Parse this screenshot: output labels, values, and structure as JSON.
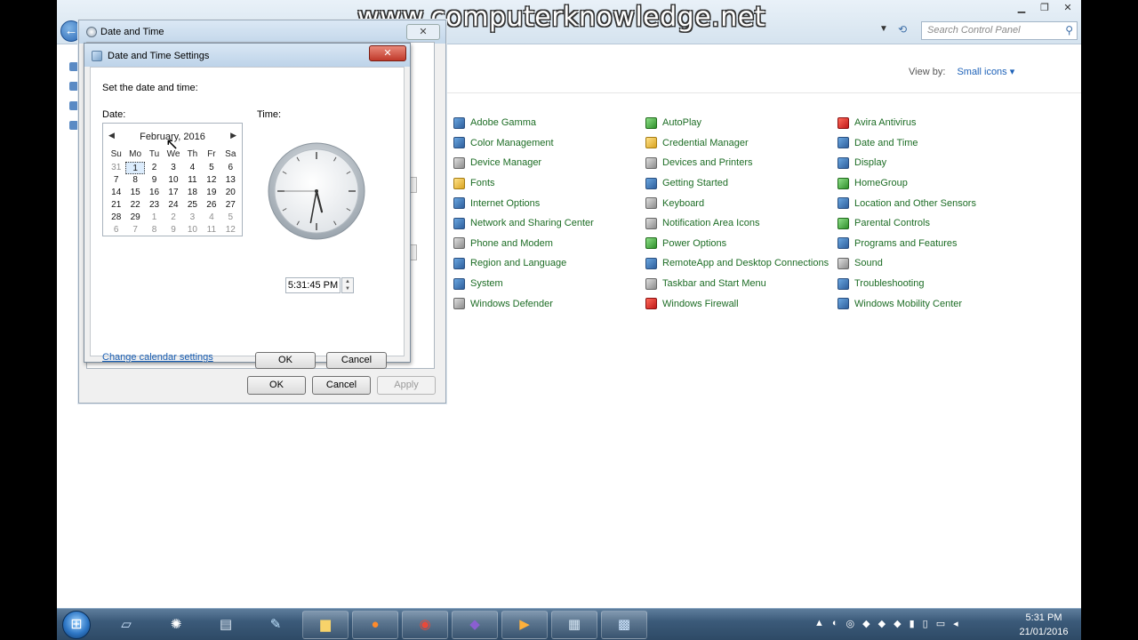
{
  "watermark": "www.computerknowledge.net",
  "explorer": {
    "search_placeholder": "Search Control Panel",
    "view_by_label": "View by:",
    "view_by_value": "Small icons ▾"
  },
  "control_panel_items": [
    {
      "label": "Adobe Gamma",
      "icon": "adobe-gamma-icon",
      "color": "blue"
    },
    {
      "label": "AutoPlay",
      "icon": "autoplay-icon",
      "color": "green"
    },
    {
      "label": "Avira Antivirus",
      "icon": "avira-icon",
      "color": "red"
    },
    {
      "label": "Color Management",
      "icon": "color-management-icon",
      "color": "blue"
    },
    {
      "label": "Credential Manager",
      "icon": "credential-manager-icon",
      "color": "yellow"
    },
    {
      "label": "Date and Time",
      "icon": "date-and-time-icon",
      "color": "blue"
    },
    {
      "label": "Device Manager",
      "icon": "device-manager-icon",
      "color": "gray"
    },
    {
      "label": "Devices and Printers",
      "icon": "devices-printers-icon",
      "color": "gray"
    },
    {
      "label": "Display",
      "icon": "display-icon",
      "color": "blue"
    },
    {
      "label": "Fonts",
      "icon": "fonts-icon",
      "color": "yellow"
    },
    {
      "label": "Getting Started",
      "icon": "getting-started-icon",
      "color": "blue"
    },
    {
      "label": "HomeGroup",
      "icon": "homegroup-icon",
      "color": "green"
    },
    {
      "label": "Internet Options",
      "icon": "internet-options-icon",
      "color": "blue"
    },
    {
      "label": "Keyboard",
      "icon": "keyboard-icon",
      "color": "gray"
    },
    {
      "label": "Location and Other Sensors",
      "icon": "location-sensors-icon",
      "color": "blue"
    },
    {
      "label": "Network and Sharing Center",
      "icon": "network-sharing-icon",
      "color": "blue"
    },
    {
      "label": "Notification Area Icons",
      "icon": "notification-area-icon",
      "color": "gray"
    },
    {
      "label": "Parental Controls",
      "icon": "parental-controls-icon",
      "color": "green"
    },
    {
      "label": "Phone and Modem",
      "icon": "phone-modem-icon",
      "color": "gray"
    },
    {
      "label": "Power Options",
      "icon": "power-options-icon",
      "color": "green"
    },
    {
      "label": "Programs and Features",
      "icon": "programs-features-icon",
      "color": "blue"
    },
    {
      "label": "Region and Language",
      "icon": "region-language-icon",
      "color": "blue"
    },
    {
      "label": "RemoteApp and Desktop Connections",
      "icon": "remoteapp-icon",
      "color": "blue"
    },
    {
      "label": "Sound",
      "icon": "sound-icon",
      "color": "gray"
    },
    {
      "label": "System",
      "icon": "system-icon",
      "color": "blue"
    },
    {
      "label": "Taskbar and Start Menu",
      "icon": "taskbar-start-icon",
      "color": "gray"
    },
    {
      "label": "Troubleshooting",
      "icon": "troubleshooting-icon",
      "color": "blue"
    },
    {
      "label": "Windows Defender",
      "icon": "windows-defender-icon",
      "color": "gray"
    },
    {
      "label": "Windows Firewall",
      "icon": "windows-firewall-icon",
      "color": "red"
    },
    {
      "label": "Windows Mobility Center",
      "icon": "mobility-center-icon",
      "color": "blue"
    }
  ],
  "outer_dialog": {
    "title": "Date and Time",
    "ok_label": "OK",
    "cancel_label": "Cancel",
    "apply_label": "Apply"
  },
  "settings_dialog": {
    "title": "Date and Time Settings",
    "heading": "Set the date and time:",
    "date_label": "Date:",
    "time_label": "Time:",
    "calendar_month": "February, 2016",
    "days_of_week": [
      "Su",
      "Mo",
      "Tu",
      "We",
      "Th",
      "Fr",
      "Sa"
    ],
    "days": [
      [
        "31",
        "other"
      ],
      [
        "1",
        "selected"
      ],
      [
        "2",
        ""
      ],
      [
        "3",
        ""
      ],
      [
        "4",
        ""
      ],
      [
        "5",
        ""
      ],
      [
        "6",
        ""
      ],
      [
        "7",
        ""
      ],
      [
        "8",
        ""
      ],
      [
        "9",
        ""
      ],
      [
        "10",
        ""
      ],
      [
        "11",
        ""
      ],
      [
        "12",
        ""
      ],
      [
        "13",
        ""
      ],
      [
        "14",
        ""
      ],
      [
        "15",
        ""
      ],
      [
        "16",
        ""
      ],
      [
        "17",
        ""
      ],
      [
        "18",
        ""
      ],
      [
        "19",
        ""
      ],
      [
        "20",
        ""
      ],
      [
        "21",
        ""
      ],
      [
        "22",
        ""
      ],
      [
        "23",
        ""
      ],
      [
        "24",
        ""
      ],
      [
        "25",
        ""
      ],
      [
        "26",
        ""
      ],
      [
        "27",
        ""
      ],
      [
        "28",
        ""
      ],
      [
        "29",
        ""
      ],
      [
        "1",
        "other"
      ],
      [
        "2",
        "other"
      ],
      [
        "3",
        "other"
      ],
      [
        "4",
        "other"
      ],
      [
        "5",
        "other"
      ],
      [
        "6",
        "other"
      ],
      [
        "7",
        "other"
      ],
      [
        "8",
        "other"
      ],
      [
        "9",
        "other"
      ],
      [
        "10",
        "other"
      ],
      [
        "11",
        "other"
      ],
      [
        "12",
        "other"
      ]
    ],
    "time_value": "5:31:45 PM",
    "clock": {
      "hour": 5,
      "minute": 31,
      "second": 45
    },
    "change_calendar_link": "Change calendar settings",
    "ok_label": "OK",
    "cancel_label": "Cancel"
  },
  "taskbar": {
    "clock_time": "5:31 PM",
    "clock_date": "21/01/2016",
    "apps": [
      {
        "name": "taskbar-app-1",
        "icon": "▱"
      },
      {
        "name": "taskbar-app-2",
        "icon": "✺"
      },
      {
        "name": "taskbar-app-3",
        "icon": "▤"
      },
      {
        "name": "taskbar-app-4",
        "icon": "✎"
      },
      {
        "name": "taskbar-explorer",
        "icon": "▆"
      },
      {
        "name": "taskbar-firefox",
        "icon": "●"
      },
      {
        "name": "taskbar-chrome",
        "icon": "◉"
      },
      {
        "name": "taskbar-visual-studio",
        "icon": "◆"
      },
      {
        "name": "taskbar-app-9",
        "icon": "▶"
      },
      {
        "name": "taskbar-app-10",
        "icon": "▦"
      },
      {
        "name": "taskbar-control-panel",
        "icon": "▩"
      }
    ],
    "tray_icons": [
      "▲",
      "◐",
      "◎",
      "◆",
      "◆",
      "◆",
      "▮",
      "▯",
      "▭",
      "◂"
    ]
  }
}
